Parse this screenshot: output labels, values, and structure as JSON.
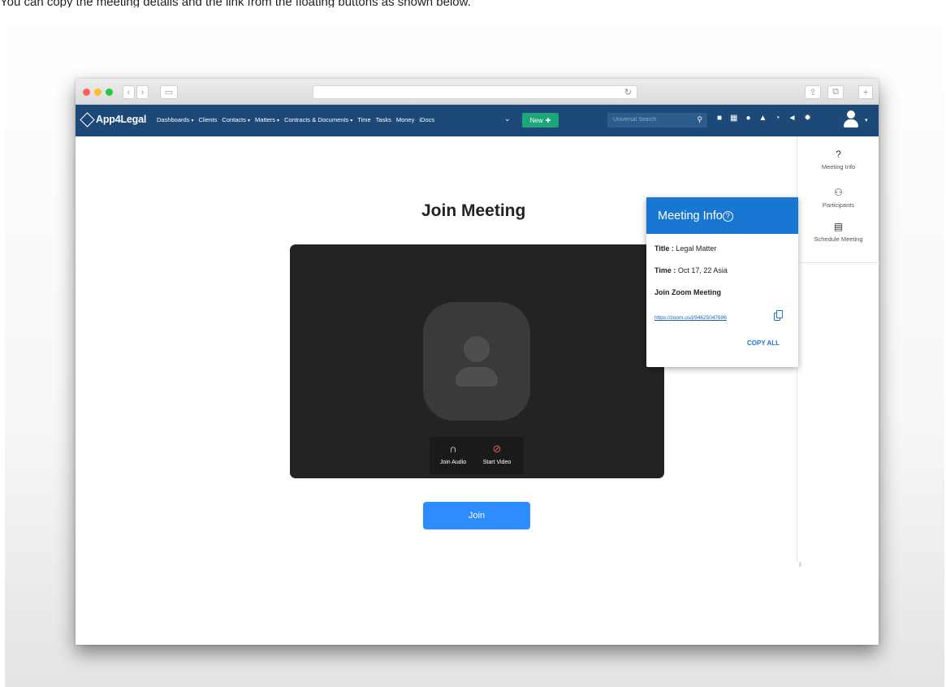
{
  "caption": "You can copy the meeting details and the link from the floating buttons as shown below.",
  "browser": {
    "colors": {
      "close": "#ff5f57",
      "minimize": "#febc2e",
      "maximize": "#28c840"
    }
  },
  "navbar": {
    "brand": "App4Legal",
    "menu": [
      {
        "label": "Dashboards",
        "caret": true
      },
      {
        "label": "Clients",
        "caret": false
      },
      {
        "label": "Contacts",
        "caret": true
      },
      {
        "label": "Matters",
        "caret": true
      },
      {
        "label": "Contracts & Documents",
        "caret": true
      },
      {
        "label": "Time",
        "caret": false
      },
      {
        "label": "Tasks",
        "caret": false
      },
      {
        "label": "Money",
        "caret": false
      },
      {
        "label": "iDocs",
        "caret": false
      }
    ],
    "more_glyph": "⌄",
    "new_label": "New",
    "search_placeholder": "Universal Search",
    "accent": "#1d4979"
  },
  "main": {
    "title": "Join Meeting",
    "join_audio": "Join Audio",
    "start_video": "Start Video",
    "join_button": "Join"
  },
  "rightbar": {
    "meeting_info": "Meeting Info",
    "participants": "Participants",
    "schedule_meeting": "Schedule Meeting"
  },
  "popup": {
    "header": "Meeting Info",
    "title_label": "Title :",
    "title_value": "Legal Matter",
    "time_label": "Time :",
    "time_value": "Oct 17, 22 Asia",
    "join_heading": "Join Zoom Meeting",
    "link": "https://zoom.us/j/94625047696",
    "copy_all": "COPY ALL"
  }
}
